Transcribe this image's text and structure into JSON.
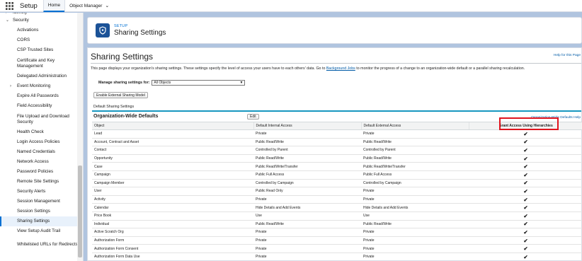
{
  "topnav": {
    "app_name": "Setup",
    "tabs": [
      {
        "label": "Home",
        "active": true
      },
      {
        "label": "Object Manager",
        "active": false
      }
    ]
  },
  "sidebar": {
    "items": [
      {
        "label": "Identity",
        "level": "top",
        "twisty": "›"
      },
      {
        "label": "Security",
        "level": "top",
        "twisty": "⌄"
      },
      {
        "label": "Activations"
      },
      {
        "label": "CORS"
      },
      {
        "label": "CSP Trusted Sites"
      },
      {
        "label": "Certificate and Key Management"
      },
      {
        "label": "Delegated Administration"
      },
      {
        "label": "Event Monitoring",
        "twisty": "›"
      },
      {
        "label": "Expire All Passwords"
      },
      {
        "label": "Field Accessibility"
      },
      {
        "label": "File Upload and Download Security"
      },
      {
        "label": "Health Check"
      },
      {
        "label": "Login Access Policies"
      },
      {
        "label": "Named Credentials"
      },
      {
        "label": "Network Access"
      },
      {
        "label": "Password Policies"
      },
      {
        "label": "Remote Site Settings"
      },
      {
        "label": "Security Alerts"
      },
      {
        "label": "Session Management"
      },
      {
        "label": "Session Settings"
      },
      {
        "label": "Sharing Settings",
        "selected": true
      },
      {
        "label": "View Setup Audit Trail"
      },
      {
        "label": "Whitelisted URLs for Redirects"
      }
    ]
  },
  "header": {
    "sub": "SETUP",
    "title": "Sharing Settings"
  },
  "page": {
    "heading": "Sharing Settings",
    "help_link": "Help for this Page",
    "desc_before": "This page displays your organization's sharing settings. These settings specify the level of access your users have to each others' data. Go to ",
    "desc_link": "Background Jobs",
    "desc_after": " to monitor the progress of a change to an organization-wide default or a parallel sharing recalculation.",
    "manage_label": "Manage sharing settings for:",
    "manage_value": "All Objects",
    "ext_button": "Enable External Sharing Model",
    "section_label": "Default Sharing Settings",
    "owd_title": "Organization-Wide Defaults",
    "edit_button": "Edit",
    "owd_help": "Organization-Wide Defaults Help"
  },
  "table": {
    "headers": [
      "Object",
      "Default Internal Access",
      "Default External Access",
      "Grant Access Using Hierarchies"
    ],
    "rows": [
      {
        "object": "Lead",
        "internal": "Private",
        "external": "Private",
        "grant": "✔"
      },
      {
        "object": "Account, Contract and Asset",
        "internal": "Public Read/Write",
        "external": "Public Read/Write",
        "grant": "✔"
      },
      {
        "object": "Contact",
        "internal": "Controlled by Parent",
        "external": "Controlled by Parent",
        "grant": "✔"
      },
      {
        "object": "Opportunity",
        "internal": "Public Read/Write",
        "external": "Public Read/Write",
        "grant": "✔"
      },
      {
        "object": "Case",
        "internal": "Public Read/Write/Transfer",
        "external": "Public Read/Write/Transfer",
        "grant": "✔"
      },
      {
        "object": "Campaign",
        "internal": "Public Full Access",
        "external": "Public Full Access",
        "grant": "✔"
      },
      {
        "object": "Campaign Member",
        "internal": "Controlled by Campaign",
        "external": "Controlled by Campaign",
        "grant": "✔"
      },
      {
        "object": "User",
        "internal": "Public Read Only",
        "external": "Private",
        "grant": "✔"
      },
      {
        "object": "Activity",
        "internal": "Private",
        "external": "Private",
        "grant": "✔"
      },
      {
        "object": "Calendar",
        "internal": "Hide Details and Add Events",
        "external": "Hide Details and Add Events",
        "grant": "✔"
      },
      {
        "object": "Price Book",
        "internal": "Use",
        "external": "Use",
        "grant": "✔"
      },
      {
        "object": "Individual",
        "internal": "Public Read/Write",
        "external": "Public Read/Write",
        "grant": "✔"
      },
      {
        "object": "Active Scratch Org",
        "internal": "Private",
        "external": "Private",
        "grant": "✔"
      },
      {
        "object": "Authorization Form",
        "internal": "Private",
        "external": "Private",
        "grant": "✔"
      },
      {
        "object": "Authorization Form Consent",
        "internal": "Private",
        "external": "Private",
        "grant": "✔"
      },
      {
        "object": "Authorization Form Data Use",
        "internal": "Private",
        "external": "Private",
        "grant": "✔"
      }
    ]
  },
  "colors": {
    "brand_blue": "#0070d2",
    "header_icon": "#1b5297",
    "page_bg": "#b0c4df",
    "highlight_box": "#e0141e"
  }
}
